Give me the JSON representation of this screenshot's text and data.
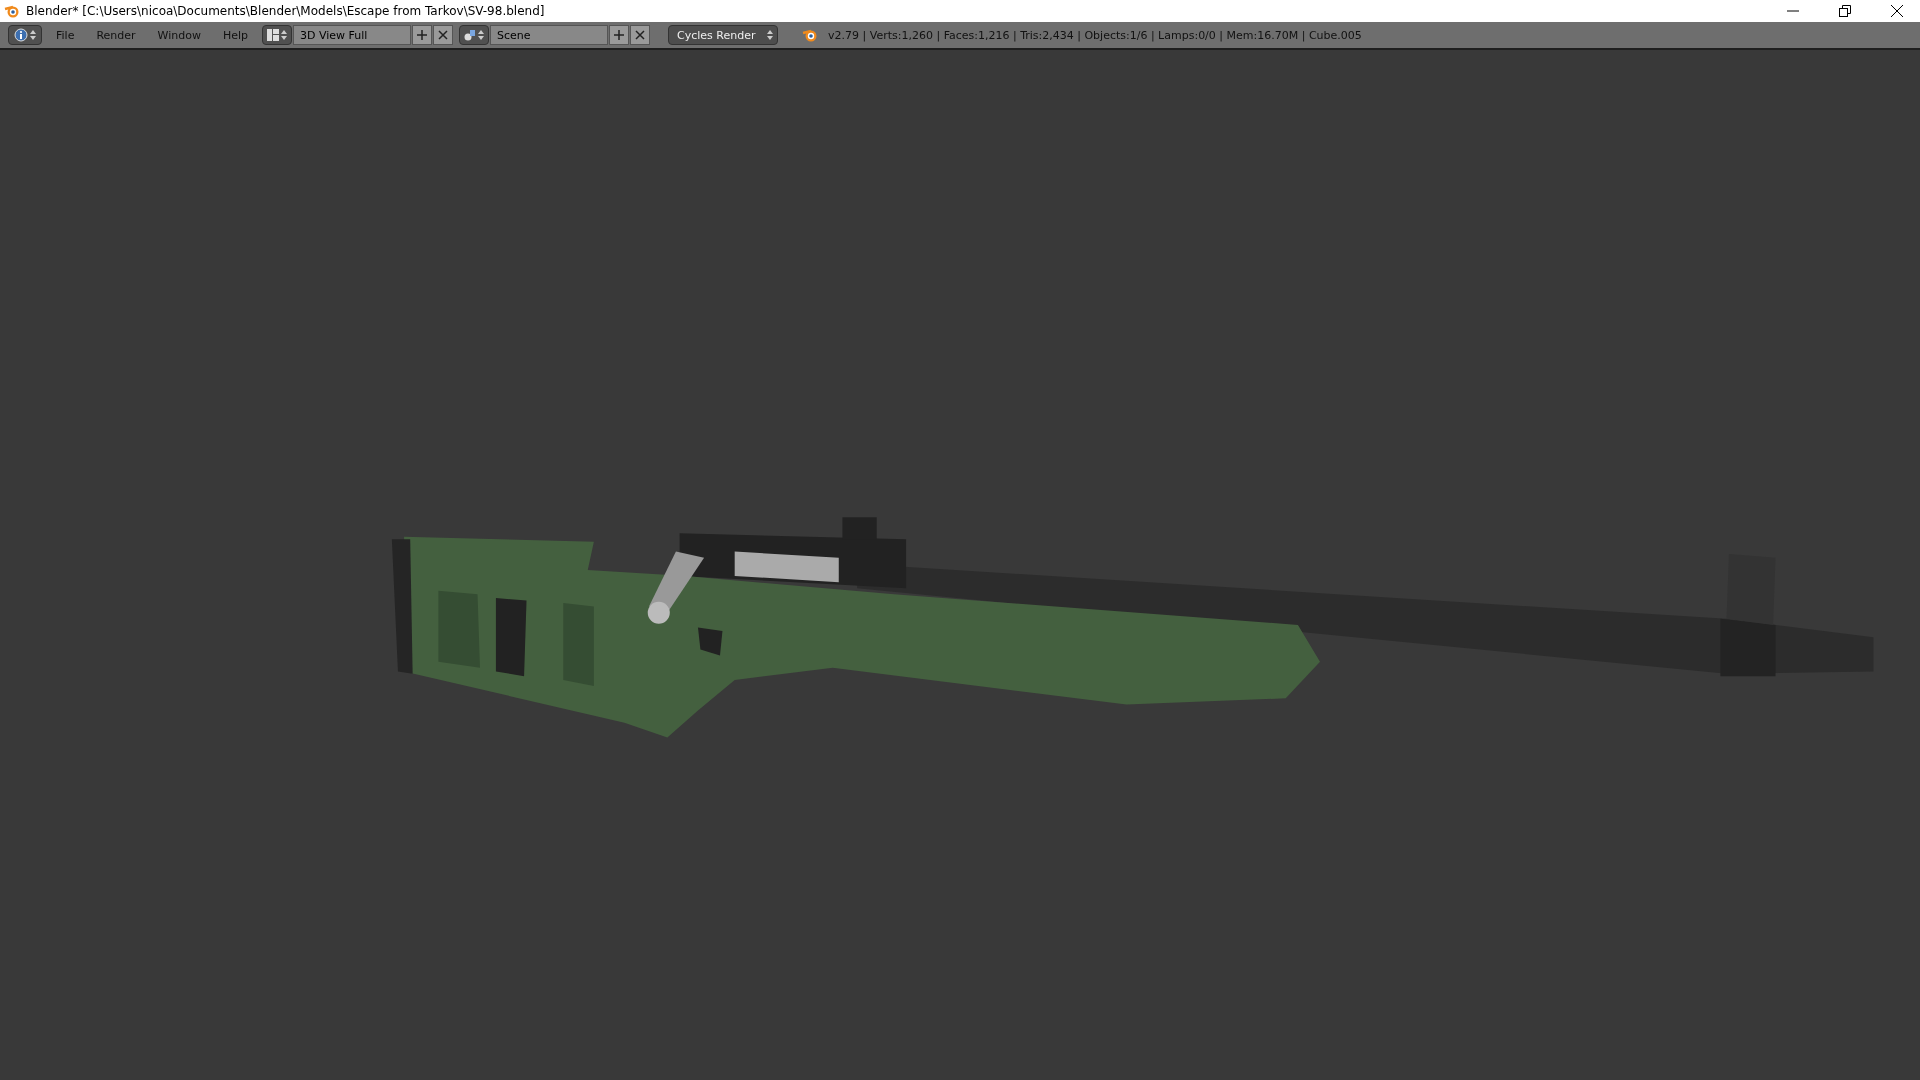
{
  "window": {
    "title": "Blender* [C:\\Users\\nicoa\\Documents\\Blender\\Models\\Escape from Tarkov\\SV-98.blend]"
  },
  "menus": [
    "File",
    "Render",
    "Window",
    "Help"
  ],
  "screen_layout": {
    "name": "3D View Full"
  },
  "scene": {
    "name": "Scene"
  },
  "render_engine": "Cycles Render",
  "stats": "v2.79 | Verts:1,260 | Faces:1,216 | Tris:2,434 | Objects:1/6 | Lamps:0/0 | Mem:16.70M | Cube.005"
}
